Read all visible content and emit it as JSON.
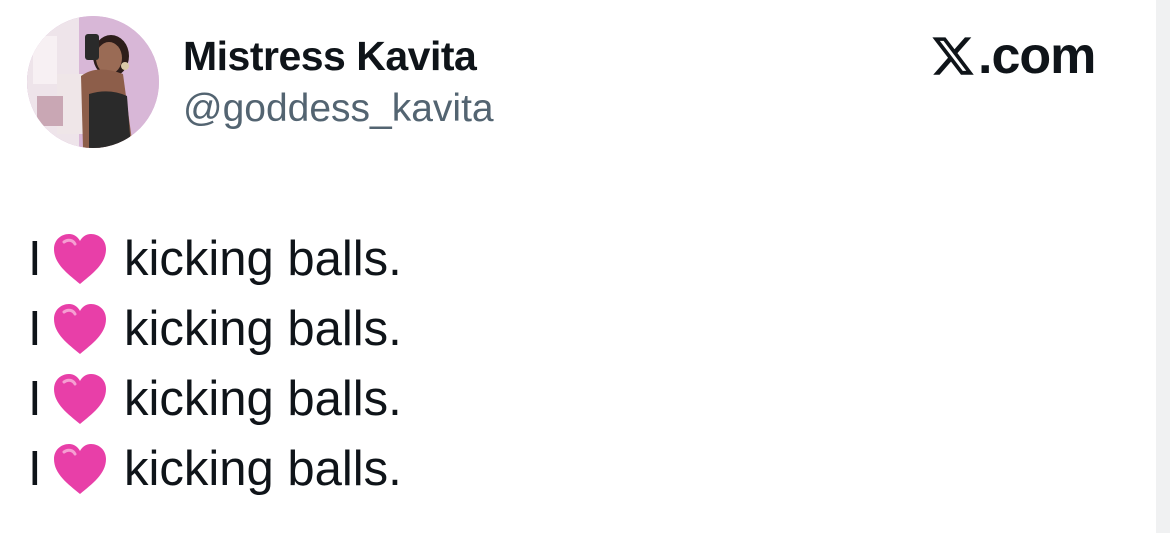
{
  "profile": {
    "display_name": "Mistress Kavita",
    "handle": "@goddess_kavita",
    "avatar_icon": "profile-photo"
  },
  "brand": {
    "logo_icon": "x-logo-icon",
    "text": ".com"
  },
  "tweet": {
    "lines": [
      {
        "pronoun": "I",
        "emoji": "pink-heart-icon",
        "text": "kicking balls."
      },
      {
        "pronoun": "I",
        "emoji": "pink-heart-icon",
        "text": "kicking balls."
      },
      {
        "pronoun": "I",
        "emoji": "pink-heart-icon",
        "text": "kicking balls."
      },
      {
        "pronoun": "I",
        "emoji": "pink-heart-icon",
        "text": "kicking balls."
      }
    ]
  },
  "colors": {
    "text_primary": "#0f1419",
    "text_secondary": "#536471",
    "heart": "#e83fa8",
    "background": "#ffffff"
  }
}
